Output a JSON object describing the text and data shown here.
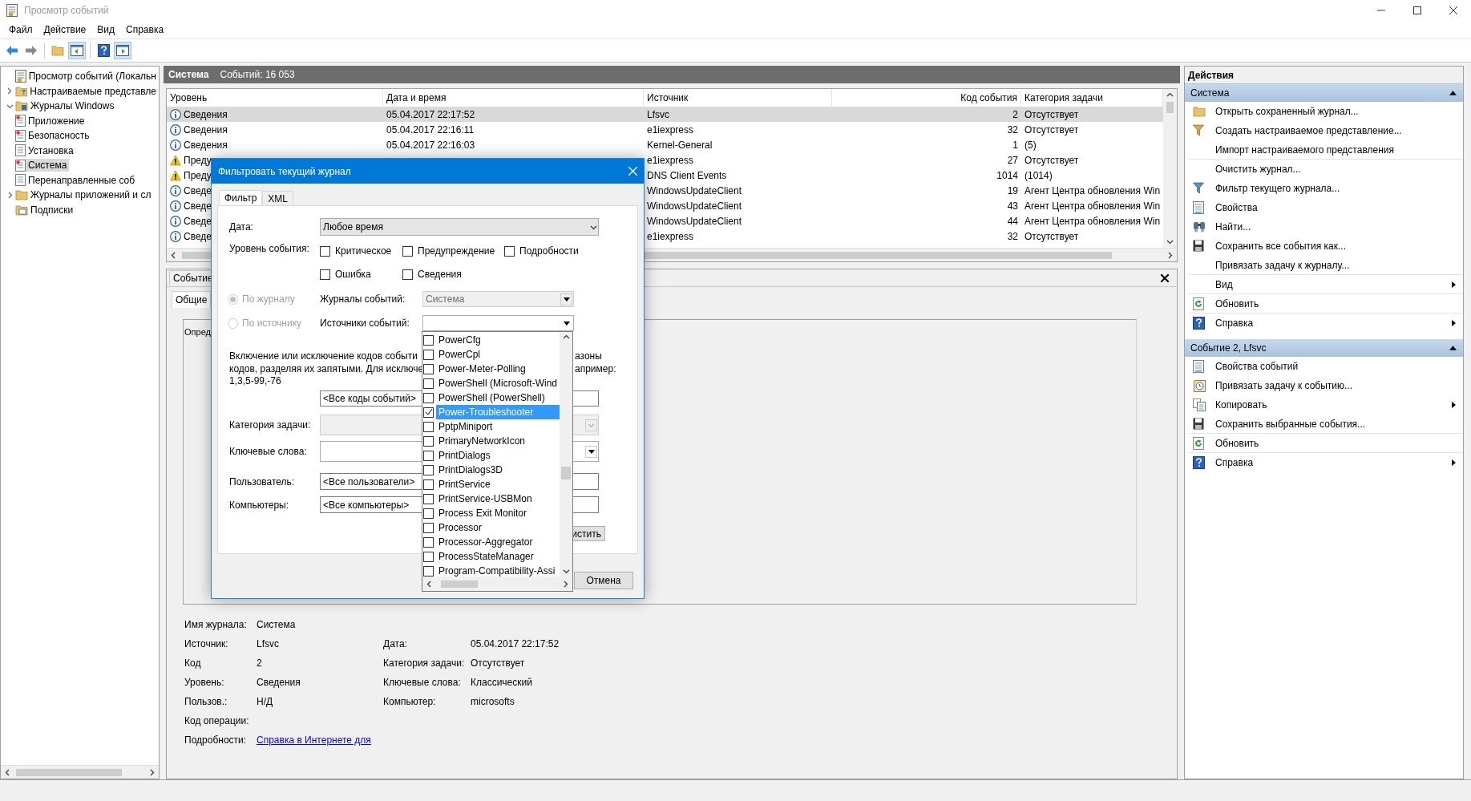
{
  "window": {
    "title": "Просмотр событий"
  },
  "menu": [
    "Файл",
    "Действие",
    "Вид",
    "Справка"
  ],
  "tree": [
    {
      "label": "Просмотр событий (Локальн",
      "kind": "viewer",
      "selected": false,
      "children": [
        {
          "label": "Настраиваемые представле",
          "kind": "filter-folder",
          "selected": false,
          "expanded": false
        },
        {
          "label": "Журналы Windows",
          "kind": "logs-folder",
          "selected": false,
          "expanded": true,
          "children": [
            {
              "label": "Приложение",
              "kind": "flagged-log",
              "selected": false
            },
            {
              "label": "Безопасность",
              "kind": "flagged-log",
              "selected": false
            },
            {
              "label": "Установка",
              "kind": "log",
              "selected": false
            },
            {
              "label": "Система",
              "kind": "flagged-log",
              "selected": true
            },
            {
              "label": "Перенаправленные соб",
              "kind": "log",
              "selected": false
            }
          ]
        },
        {
          "label": "Журналы приложений и сл",
          "kind": "folder",
          "selected": false,
          "expanded": false
        },
        {
          "label": "Подписки",
          "kind": "subscriptions",
          "selected": false
        }
      ]
    }
  ],
  "log": {
    "title": "Система",
    "count": "Событий: 16 053"
  },
  "table": {
    "columns": [
      "Уровень",
      "Дата и время",
      "Источник",
      "Код события",
      "Категория задачи"
    ],
    "rows": [
      {
        "kind": "info",
        "level": "Сведения",
        "date": "05.04.2017 22:17:52",
        "source": "Lfsvc",
        "code": "2",
        "category": "Отсутствует",
        "selected": true
      },
      {
        "kind": "info",
        "level": "Сведения",
        "date": "05.04.2017 22:16:11",
        "source": "e1iexpress",
        "code": "32",
        "category": "Отсутствует",
        "selected": false
      },
      {
        "kind": "info",
        "level": "Сведения",
        "date": "05.04.2017 22:16:03",
        "source": "Kernel-General",
        "code": "1",
        "category": "(5)",
        "selected": false
      },
      {
        "kind": "warning",
        "level": "Преду",
        "source": "e1iexpress",
        "code": "27",
        "category": "Отсутствует",
        "selected": false
      },
      {
        "kind": "warning",
        "level": "Преду",
        "source": "DNS Client Events",
        "code": "1014",
        "category": "(1014)",
        "selected": false
      },
      {
        "kind": "info",
        "level": "Сведе",
        "source": "WindowsUpdateClient",
        "code": "19",
        "category": "Агент Центра обновления Win",
        "selected": false
      },
      {
        "kind": "info",
        "level": "Сведе",
        "source": "WindowsUpdateClient",
        "code": "43",
        "category": "Агент Центра обновления Win",
        "selected": false
      },
      {
        "kind": "info",
        "level": "Сведе",
        "source": "WindowsUpdateClient",
        "code": "44",
        "category": "Агент Центра обновления Win",
        "selected": false
      },
      {
        "kind": "info",
        "level": "Сведе",
        "source": "e1iexpress",
        "code": "32",
        "category": "Отсутствует",
        "selected": false
      }
    ]
  },
  "event_pane": {
    "tab": "Событие",
    "inner_tab": "Общие",
    "description": "Опред",
    "fields": [
      {
        "label": "Имя журнала:",
        "value": "Система"
      },
      {
        "label": "Источник:",
        "value": "Lfsvc",
        "label_2": "Дата:",
        "value_2": "05.04.2017 22:17:52"
      },
      {
        "label": "Код",
        "value": "2",
        "label_2": "Категория задачи:",
        "value_2": "Отсутствует"
      },
      {
        "label": "Уровень:",
        "value": "Сведения",
        "label_2": "Ключевые слова:",
        "value_2": "Классический"
      },
      {
        "label": "Пользов.:",
        "value": "Н/Д",
        "label_2": "Компьютер:",
        "value_2": "microsofts"
      },
      {
        "label": "Код операции:"
      },
      {
        "label": "Подробности:",
        "link": "Справка в Интернете для "
      }
    ]
  },
  "actions": {
    "title": "Действия",
    "sections": [
      {
        "title": "Система",
        "expanded": true,
        "items": [
          {
            "label": "Открыть сохраненный журнал...",
            "kind": "folder"
          },
          {
            "label": "Создать настраиваемое представление...",
            "kind": "color-funnel"
          },
          {
            "label": "Импорт настраиваемого представления",
            "divider": true
          },
          {
            "label": "Очистить журнал..."
          },
          {
            "label": "Фильтр текущего журнала...",
            "kind": "funnel"
          },
          {
            "label": "Свойства",
            "kind": "properties"
          },
          {
            "label": "Найти...",
            "kind": "binoculars"
          },
          {
            "label": "Сохранить все события как...",
            "kind": "floppy"
          },
          {
            "label": "Привязать задачу к журналу...",
            "divider": true
          },
          {
            "label": "Вид",
            "submenu": true,
            "divider": true
          },
          {
            "label": "Обновить",
            "kind": "refresh",
            "divider": true
          },
          {
            "label": "Справка",
            "kind": "help",
            "submenu": true
          }
        ]
      },
      {
        "title": "Событие 2, Lfsvc",
        "expanded": true,
        "items": [
          {
            "label": "Свойства событий",
            "kind": "properties"
          },
          {
            "label": "Привязать задачу к событию...",
            "kind": "clock"
          },
          {
            "label": "Копировать",
            "kind": "copy",
            "submenu": true
          },
          {
            "label": "Сохранить выбранные события...",
            "kind": "floppy",
            "divider": true
          },
          {
            "label": "Обновить",
            "kind": "refresh",
            "divider": true
          },
          {
            "label": "Справка",
            "kind": "help",
            "submenu": true
          }
        ]
      }
    ]
  },
  "dialog": {
    "title": "Фильтровать текущий журнал",
    "tabs": [
      {
        "label": "Фильтр",
        "selected": true
      },
      {
        "label": "XML",
        "selected": false
      }
    ],
    "date": {
      "label": "Дата:",
      "value": "Любое время"
    },
    "level": {
      "label": "Уровень события:",
      "options": [
        {
          "label": "Критическое",
          "checked": false
        },
        {
          "label": "Предупреждение",
          "checked": false
        },
        {
          "label": "Подробности",
          "checked": false
        },
        {
          "label": "Ошибка",
          "checked": false
        },
        {
          "label": "Сведения",
          "checked": false
        }
      ]
    },
    "scope": [
      {
        "label": "По журналу",
        "selected": true,
        "disabled": true
      },
      {
        "label": "По источнику",
        "selected": false,
        "disabled": true
      }
    ],
    "logs": {
      "label": "Журналы событий:",
      "value": "Система",
      "disabled": true
    },
    "sources": {
      "label": "Источники событий:",
      "items": [
        {
          "label": "PowerCfg",
          "checked": false,
          "selected": false
        },
        {
          "label": "PowerCpl",
          "checked": false,
          "selected": false
        },
        {
          "label": "Power-Meter-Polling",
          "checked": false,
          "selected": false
        },
        {
          "label": "PowerShell (Microsoft-Wind",
          "checked": false,
          "selected": false
        },
        {
          "label": "PowerShell (PowerShell)",
          "checked": false,
          "selected": false
        },
        {
          "label": "Power-Troubleshooter",
          "checked": true,
          "selected": true
        },
        {
          "label": "PptpMiniport",
          "checked": false,
          "selected": false
        },
        {
          "label": "PrimaryNetworkIcon",
          "checked": false,
          "selected": false
        },
        {
          "label": "PrintDialogs",
          "checked": false,
          "selected": false
        },
        {
          "label": "PrintDialogs3D",
          "checked": false,
          "selected": false
        },
        {
          "label": "PrintService",
          "checked": false,
          "selected": false
        },
        {
          "label": "PrintService-USBMon",
          "checked": false,
          "selected": false
        },
        {
          "label": "Process Exit Monitor",
          "checked": false,
          "selected": false
        },
        {
          "label": "Processor",
          "checked": false,
          "selected": false
        },
        {
          "label": "Processor-Aggregator",
          "checked": false,
          "selected": false
        },
        {
          "label": "ProcessStateManager",
          "checked": false,
          "selected": false
        },
        {
          "label": "Program-Compatibility-Assi",
          "checked": false,
          "selected": false
        }
      ]
    },
    "description_left": [
      "Включение или исключение кодов событи",
      "кодов, разделяя их запятыми. Для исключе",
      "1,3,5-99,-76"
    ],
    "description_right": [
      "азоны",
      "апример:"
    ],
    "codes": {
      "value": "<Все коды событий>"
    },
    "category": {
      "label": "Категория задачи:",
      "disabled": true
    },
    "keywords": {
      "label": "Ключевые слова:",
      "disabled": false
    },
    "user": {
      "label": "Пользователь:",
      "value": "<Все пользователи>"
    },
    "computers": {
      "label": "Компьютеры:",
      "value": "<Все компьютеры>"
    },
    "clear_button": "истить",
    "cancel_button": "Отмена"
  }
}
